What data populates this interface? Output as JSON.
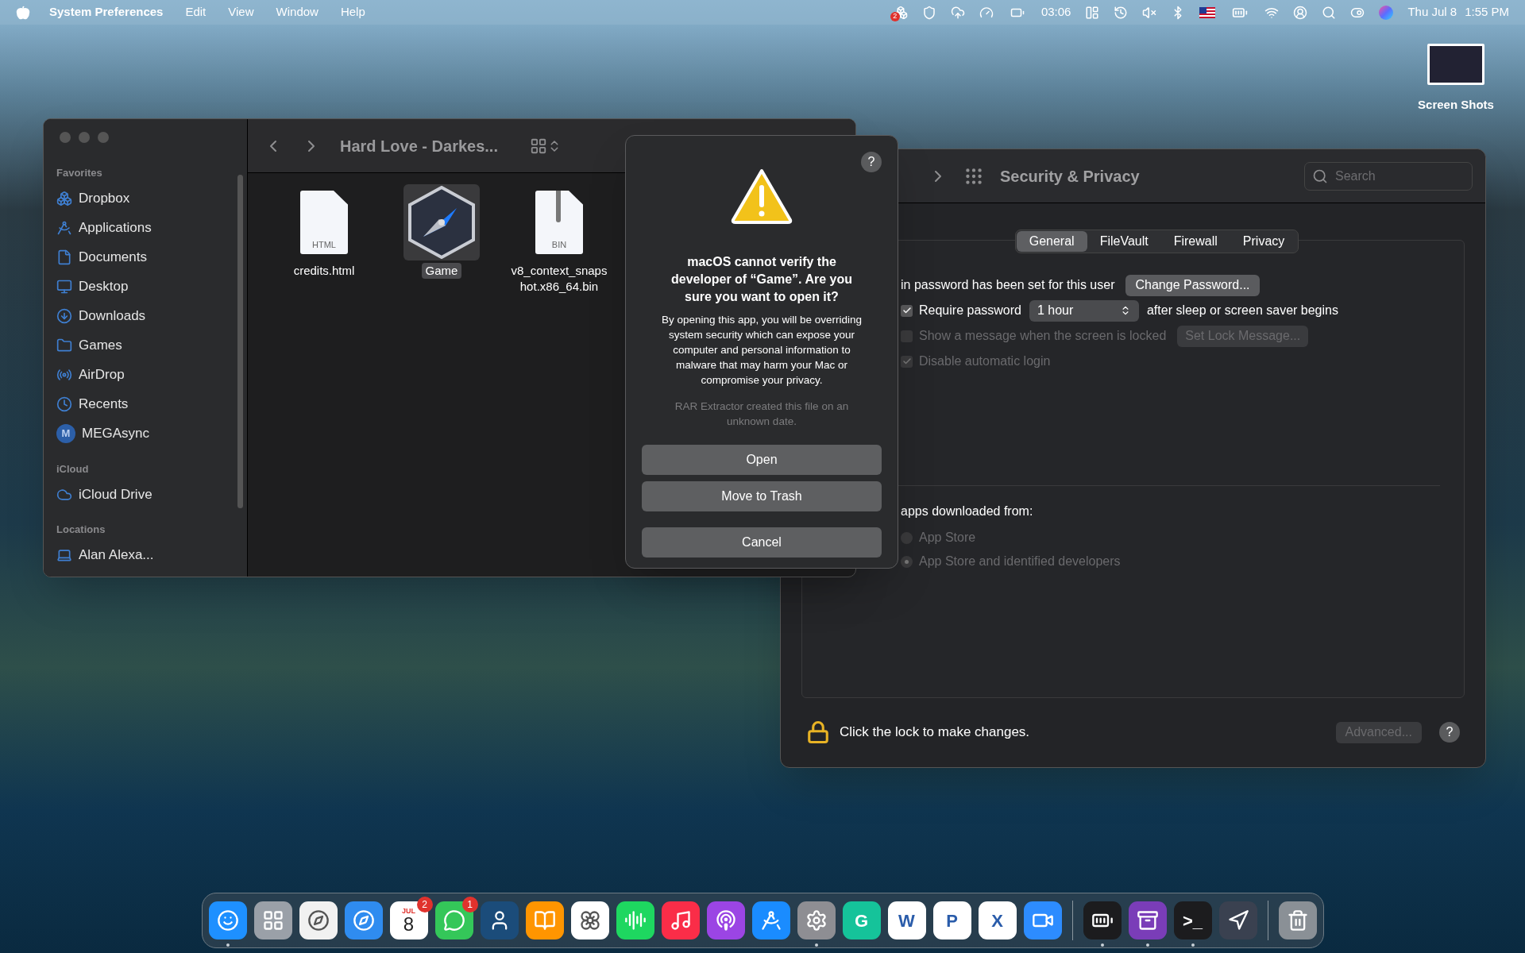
{
  "menu_bar": {
    "menus": [
      {
        "label": "System Preferences",
        "kind": "app"
      },
      {
        "label": "Edit",
        "kind": "menu"
      },
      {
        "label": "View",
        "kind": "menu"
      },
      {
        "label": "Window",
        "kind": "menu"
      },
      {
        "label": "Help",
        "kind": "menu"
      }
    ],
    "dropbox_badge": "2",
    "timer": "03:06",
    "date": "Thu Jul 8",
    "time": "1:55 PM"
  },
  "desktop_icons": [
    {
      "label": "Screen Shots"
    }
  ],
  "finder": {
    "title": "Hard Love - Darkes...",
    "sidebar": [
      {
        "heading": "Favorites",
        "items": [
          {
            "label": "Dropbox",
            "kind": "dropbox"
          },
          {
            "label": "Applications",
            "kind": "applications"
          },
          {
            "label": "Documents",
            "kind": "documents"
          },
          {
            "label": "Desktop",
            "kind": "desktop"
          },
          {
            "label": "Downloads",
            "kind": "downloads"
          },
          {
            "label": "Games",
            "kind": "folder"
          },
          {
            "label": "AirDrop",
            "kind": "airdrop"
          },
          {
            "label": "Recents",
            "kind": "recents"
          },
          {
            "label": "MEGAsync",
            "kind": "badge",
            "badge": "M"
          }
        ]
      },
      {
        "heading": "iCloud",
        "items": [
          {
            "label": "iCloud Drive",
            "kind": "cloud"
          }
        ]
      },
      {
        "heading": "Locations",
        "items": [
          {
            "label": "Alan Alexa...",
            "kind": "laptop"
          }
        ]
      }
    ],
    "files": [
      {
        "name": "credits.html",
        "kind": "document",
        "badge": "HTML",
        "selected": false
      },
      {
        "name": "Game",
        "kind": "app",
        "selected": true
      },
      {
        "name": "v8_context_snapshot.x86_64.bin",
        "kind": "archive",
        "badge": "BIN",
        "selected": false
      }
    ]
  },
  "dialog": {
    "help": "?",
    "title": "macOS cannot verify the developer of “Game”. Are you sure you want to open it?",
    "body": "By opening this app, you will be overriding system security which can expose your computer and personal information to malware that may harm your Mac or compromise your privacy.",
    "note": "RAR Extractor created this file on an unknown date.",
    "buttons": [
      "Open",
      "Move to Trash",
      "Cancel"
    ]
  },
  "security": {
    "title": "Security & Privacy",
    "search": {
      "placeholder": "Search"
    },
    "tabs": [
      {
        "label": "General",
        "selected": true
      },
      {
        "label": "FileVault",
        "selected": false
      },
      {
        "label": "Firewall",
        "selected": false
      },
      {
        "label": "Privacy",
        "selected": false
      }
    ],
    "password_text": "in password has been set for this user",
    "change_button": "Change Password...",
    "options": [
      {
        "label": "Require password",
        "checked": true,
        "disabled": false,
        "popup": "1 hour",
        "suffix": "after sleep or screen saver begins"
      },
      {
        "label": "Show a message when the screen is locked",
        "checked": false,
        "disabled": true,
        "button": "Set Lock Message..."
      },
      {
        "label": "Disable automatic login",
        "checked": true,
        "disabled": true
      }
    ],
    "allow_heading": "apps downloaded from:",
    "radios": [
      {
        "label": "App Store",
        "selected": false,
        "disabled": true
      },
      {
        "label": "App Store and identified developers",
        "selected": true,
        "disabled": true
      }
    ],
    "lock_text": "Click the lock to make changes.",
    "advanced": {
      "label": "Advanced...",
      "disabled": true
    },
    "help": "?"
  },
  "dock": {
    "items": [
      {
        "kind": "finder",
        "color": "#1e90ff",
        "running": true
      },
      {
        "kind": "launchpad",
        "color": "#9aa0a8",
        "running": false
      },
      {
        "kind": "chrome",
        "color": "#f1f1f1",
        "running": false
      },
      {
        "kind": "safari",
        "color": "#2f8cf0",
        "running": false
      },
      {
        "kind": "calendar",
        "color": "#ffffff",
        "running": false,
        "month": "JUL",
        "day": "8",
        "badge": "2"
      },
      {
        "kind": "messages",
        "color": "#34c759",
        "running": false,
        "badge": "1"
      },
      {
        "kind": "kindle",
        "color": "#1b4c7a",
        "running": false
      },
      {
        "kind": "books",
        "color": "#ff9500",
        "running": false
      },
      {
        "kind": "photos",
        "color": "#ffffff",
        "running": false
      },
      {
        "kind": "spotify",
        "color": "#1ed760",
        "running": false
      },
      {
        "kind": "music",
        "color": "#fa2d48",
        "running": false
      },
      {
        "kind": "podcasts",
        "color": "#9b45e4",
        "running": false
      },
      {
        "kind": "appstore",
        "color": "#1a8cff",
        "running": false
      },
      {
        "kind": "settings",
        "color": "#8e8e93",
        "running": true
      },
      {
        "kind": "grammarly",
        "color": "#15c39a",
        "running": false,
        "letter": "G"
      },
      {
        "kind": "word",
        "color": "#ffffff",
        "running": false,
        "letter": "W"
      },
      {
        "kind": "powerpoint",
        "color": "#ffffff",
        "running": false,
        "letter": "P"
      },
      {
        "kind": "excel",
        "color": "#ffffff",
        "running": false,
        "letter": "X"
      },
      {
        "kind": "zoom",
        "color": "#2d8cff",
        "running": false
      },
      {
        "kind": "separator"
      },
      {
        "kind": "battery",
        "color": "#1c1c1e",
        "running": true
      },
      {
        "kind": "rar",
        "color": "#7a3db8",
        "running": true
      },
      {
        "kind": "terminal",
        "color": "#1c1c1e",
        "running": true,
        "letter": ">_"
      },
      {
        "kind": "game",
        "color": "#3a4150",
        "running": false
      },
      {
        "kind": "separator"
      },
      {
        "kind": "trash",
        "color": "#8a9096",
        "running": false
      }
    ]
  }
}
